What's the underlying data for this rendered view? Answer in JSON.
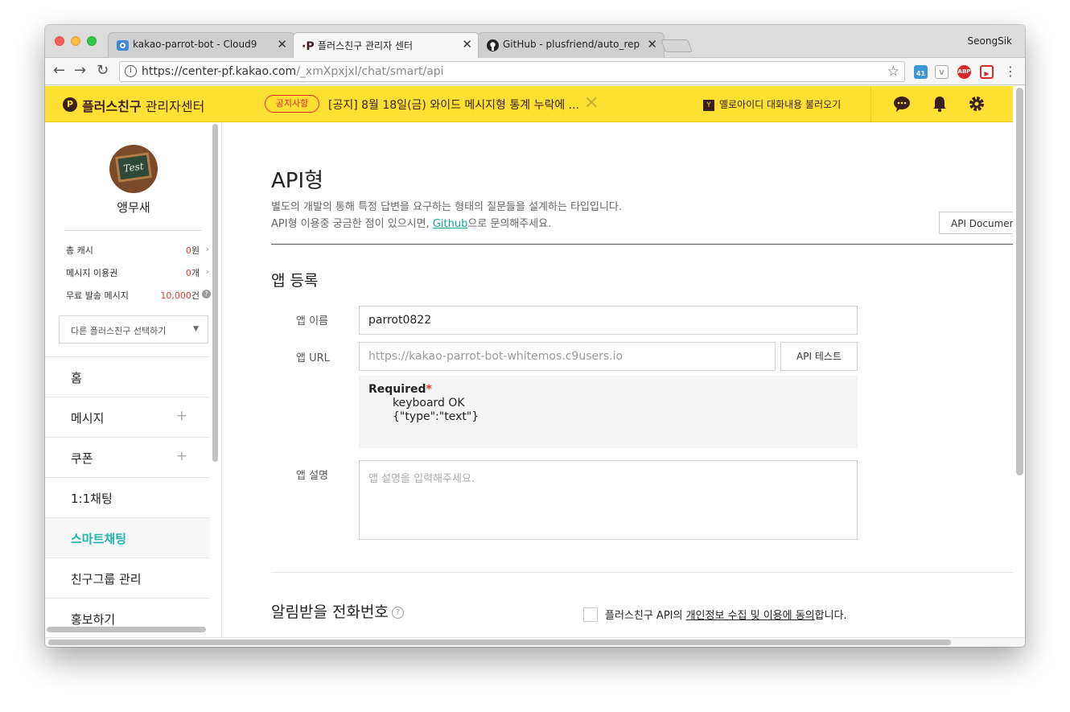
{
  "browser": {
    "tabs": [
      {
        "title": "kakao-parrot-bot - Cloud9",
        "icon": "cloud9-icon"
      },
      {
        "title": "플러스친구 관리자 센터",
        "icon": "plusfriend-icon"
      },
      {
        "title": "GitHub - plusfriend/auto_reply",
        "icon": "github-icon"
      }
    ],
    "close_glyph": "✕",
    "user": "SeongSik",
    "url_main": "https://center-pf.kakao.com",
    "url_path": "/_xmXpxjxl/chat/smart/api",
    "extension_badge": "41"
  },
  "topbar": {
    "brand_bold": "플러스친구",
    "brand_rest": "관리자센터",
    "notice_badge": "공지사항",
    "notice_text": "[공지] 8월 18일(금) 와이드 메시지형 통계 누락에 ...",
    "yellow_id_text": "옐로아이디 대화내용 불러오기",
    "colors": {
      "accent": "#fde031",
      "brand_dark": "#3a1f1d",
      "teal": "#1fb4ac",
      "red": "#e23b30"
    }
  },
  "sidebar": {
    "avatar_text": "Test",
    "profile_name": "앵무새",
    "stats": [
      {
        "label": "총 캐시",
        "value": "0",
        "unit": "원"
      },
      {
        "label": "메시지 이용권",
        "value": "0",
        "unit": "개"
      },
      {
        "label": "무료 발송 메시지",
        "value": "10,000",
        "unit": "건"
      }
    ],
    "select_label": "다른 플러스친구 선택하기",
    "menu": [
      {
        "label": "홈"
      },
      {
        "label": "메시지",
        "plus": "+"
      },
      {
        "label": "쿠폰",
        "plus": "+"
      },
      {
        "label": "1:1채팅"
      },
      {
        "label": "스마트채팅"
      },
      {
        "label": "친구그룹 관리"
      },
      {
        "label": "홍보하기"
      }
    ]
  },
  "main": {
    "title": "API형",
    "desc1": "별도의 개발의 통해 특정 답변을 요구하는 형태의 질문들을 설계하는 타입입니다.",
    "desc2_pre": "API형 이용중 궁금한 점이 있으시면, ",
    "desc2_link": "Github",
    "desc2_post": "으로 문의해주세요.",
    "api_doc_button": "API Document",
    "section_title": "앱 등록",
    "app_name_label": "앱 이름",
    "app_name_value": "parrot0822",
    "app_url_label": "앱 URL",
    "app_url_placeholder": "https://kakao-parrot-bot-whitemos.c9users.io",
    "api_test_button": "API 테스트",
    "required_title": "Required",
    "required_asterisk": "*",
    "required_line1": "keyboard OK",
    "required_line2": "{\"type\":\"text\"}",
    "app_desc_label": "앱 설명",
    "app_desc_placeholder": "앱 설명을 입력해주세요.",
    "phone_title": "알림받을 전화번호",
    "help_glyph": "?",
    "agree_pre": "플러스친구 API의 ",
    "agree_link": "개인정보 수집 및 이용에 동의",
    "agree_post": "합니다."
  }
}
